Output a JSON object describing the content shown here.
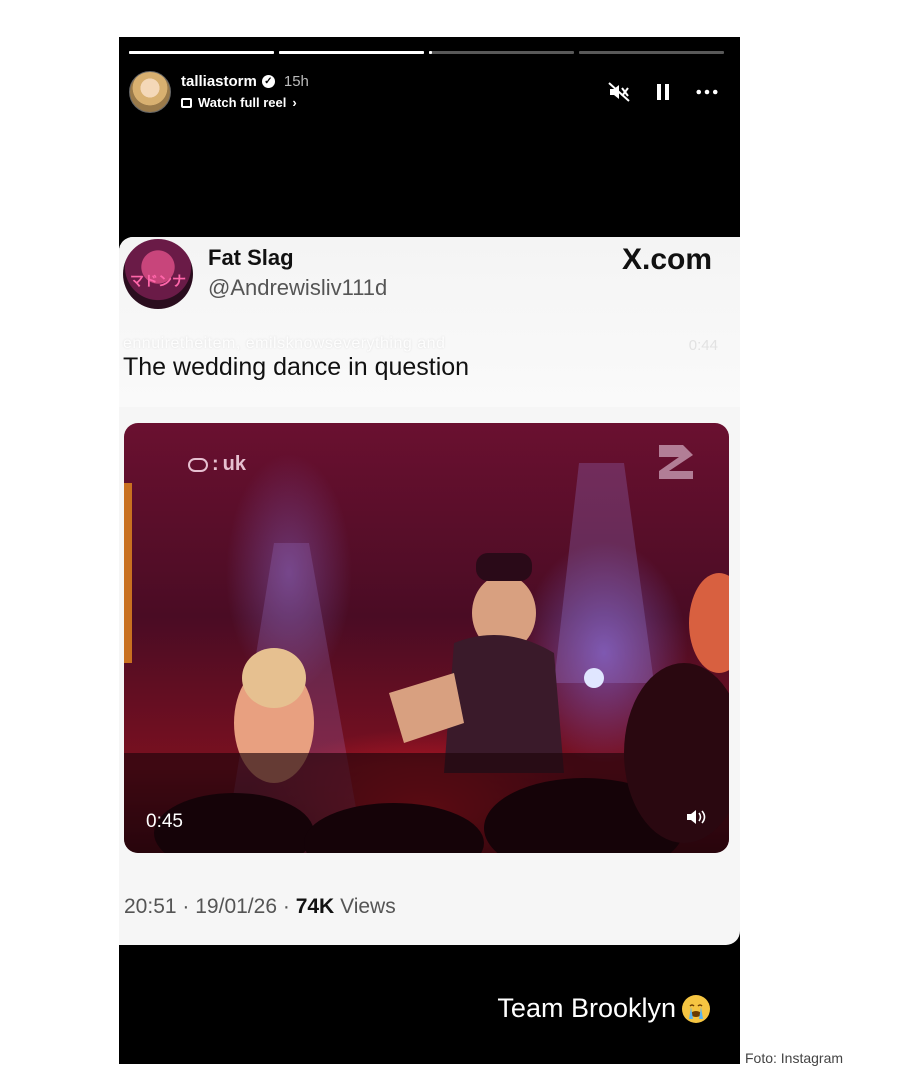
{
  "story": {
    "progress_segments": [
      1,
      1,
      0.02,
      0
    ],
    "user": {
      "name": "talliastorm",
      "time": "15h",
      "reel_label": "Watch full reel"
    },
    "icons": {
      "verified": "verified-icon",
      "reel": "reel-icon",
      "mute": "muted-speaker-icon",
      "pause": "pause-icon",
      "more": "more-icon"
    }
  },
  "tweet": {
    "display_name": "Fat Slag",
    "handle": "@Andrewisliv111d",
    "site": "X.com",
    "ghost_text": "ennuiretheitem, emilsknowseverything and",
    "ghost_time": "0:44",
    "text": "The wedding dance in question",
    "avatar_text": "マドンナ",
    "video": {
      "channel": "uk",
      "duration": "0:45"
    },
    "meta": {
      "time": "20:51",
      "date": "19/01/26",
      "views_count": "74K",
      "views_label": "Views",
      "sep": "·"
    }
  },
  "caption": "Team Brooklyn",
  "credit": "Foto: Instagram"
}
